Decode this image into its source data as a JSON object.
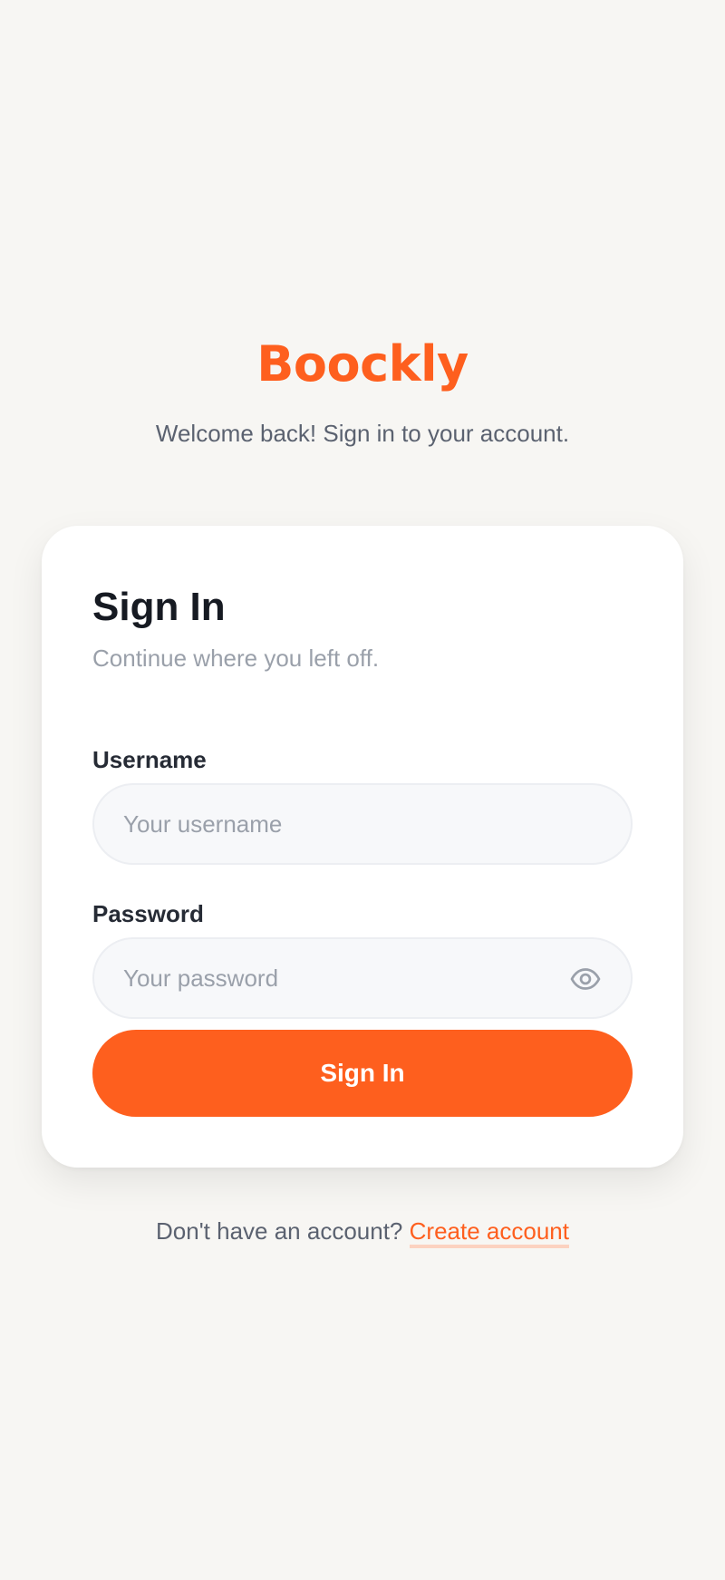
{
  "colors": {
    "brand": "#fe5f1e",
    "background": "#f7f6f3",
    "card": "#ffffff"
  },
  "brand": {
    "name": "Boockly",
    "tagline": "Welcome back! Sign in to your account."
  },
  "form": {
    "title": "Sign In",
    "subtitle": "Continue where you left off.",
    "username": {
      "label": "Username",
      "placeholder": "Your username",
      "value": ""
    },
    "password": {
      "label": "Password",
      "placeholder": "Your password",
      "value": "",
      "toggle_icon": "eye-icon"
    },
    "submit_label": "Sign In"
  },
  "footer": {
    "prompt": "Don't have an account?",
    "link_label": "Create account"
  }
}
